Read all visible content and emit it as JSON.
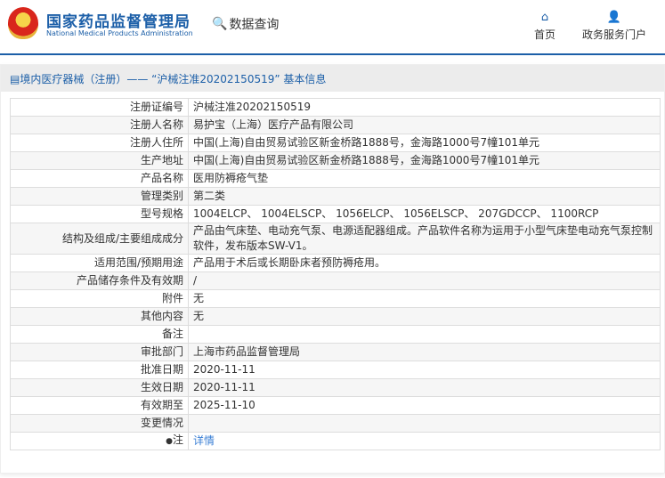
{
  "header": {
    "title": "国家药品监督管理局",
    "subtitle": "National Medical Products Administration",
    "data_query": "数据查询",
    "nav": [
      {
        "label": "首页",
        "icon": "home-icon"
      },
      {
        "label": "政务服务门户",
        "icon": "user-icon"
      }
    ]
  },
  "panel": {
    "heading": "境内医疗器械（注册）——  “沪械注准20202150519”  基本信息"
  },
  "rows": [
    {
      "label": "注册证编号",
      "value": "沪械注准20202150519"
    },
    {
      "label": "注册人名称",
      "value": "易护宝（上海）医疗产品有限公司"
    },
    {
      "label": "注册人住所",
      "value": "中国(上海)自由贸易试验区新金桥路1888号，金海路1000号7幢101单元"
    },
    {
      "label": "生产地址",
      "value": "中国(上海)自由贸易试验区新金桥路1888号，金海路1000号7幢101单元"
    },
    {
      "label": "产品名称",
      "value": "医用防褥疮气垫"
    },
    {
      "label": "管理类别",
      "value": "第二类"
    },
    {
      "label": "型号规格",
      "value": "1004ELCP、 1004ELSCP、 1056ELCP、 1056ELSCP、 207GDCCP、 1100RCP"
    },
    {
      "label": "结构及组成/主要组成成分",
      "value": "产品由气床垫、电动充气泵、电源适配器组成。产品软件名称为运用于小型气床垫电动充气泵控制软件，发布版本SW-V1。"
    },
    {
      "label": "适用范围/预期用途",
      "value": "产品用于术后或长期卧床者预防褥疮用。"
    },
    {
      "label": "产品储存条件及有效期",
      "value": "/"
    },
    {
      "label": "附件",
      "value": "无"
    },
    {
      "label": "其他内容",
      "value": "无"
    },
    {
      "label": "备注",
      "value": ""
    },
    {
      "label": "审批部门",
      "value": "上海市药品监督管理局"
    },
    {
      "label": "批准日期",
      "value": "2020-11-11"
    },
    {
      "label": "生效日期",
      "value": "2020-11-11"
    },
    {
      "label": "有效期至",
      "value": "2025-11-10"
    },
    {
      "label": "变更情况",
      "value": ""
    },
    {
      "label": "注",
      "value": "详情"
    }
  ]
}
